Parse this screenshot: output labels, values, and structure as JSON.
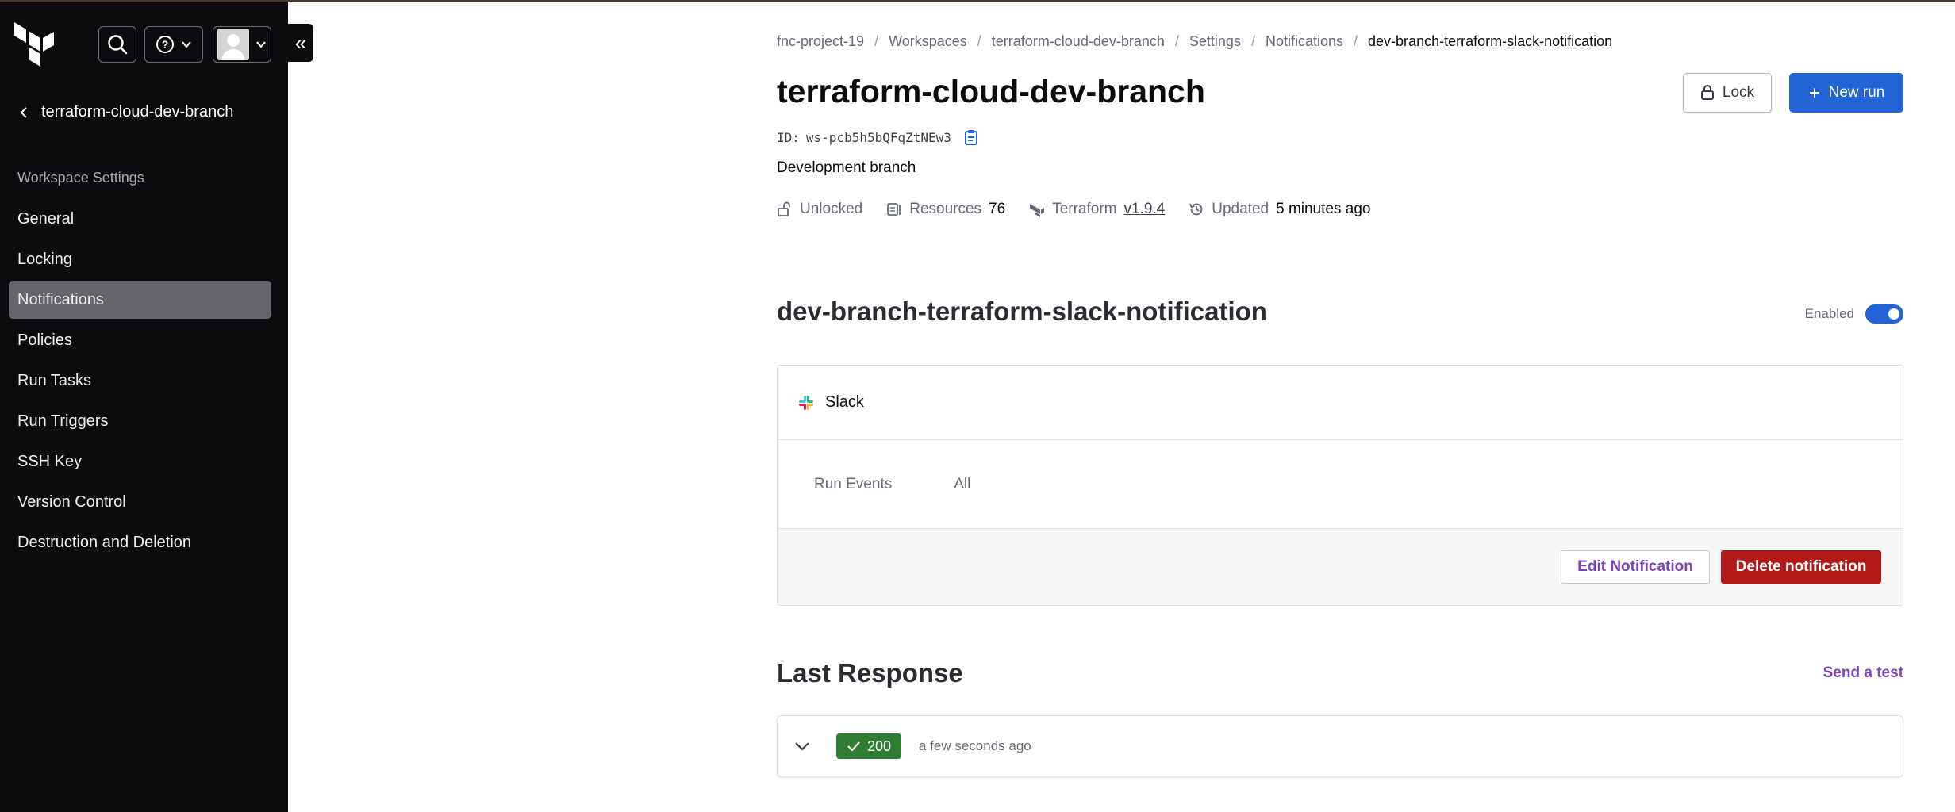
{
  "sidebar": {
    "back_label": "terraform-cloud-dev-branch",
    "section_label": "Workspace Settings",
    "items": [
      {
        "label": "General"
      },
      {
        "label": "Locking"
      },
      {
        "label": "Notifications",
        "active": true
      },
      {
        "label": "Policies"
      },
      {
        "label": "Run Tasks"
      },
      {
        "label": "Run Triggers"
      },
      {
        "label": "SSH Key"
      },
      {
        "label": "Version Control"
      },
      {
        "label": "Destruction and Deletion"
      }
    ],
    "collapse_glyph": "«"
  },
  "breadcrumb": [
    "fnc-project-19",
    "Workspaces",
    "terraform-cloud-dev-branch",
    "Settings",
    "Notifications",
    "dev-branch-terraform-slack-notification"
  ],
  "workspace": {
    "title": "terraform-cloud-dev-branch",
    "id_label": "ID:",
    "id_value": "ws-pcb5h5bQFqZtNEw3",
    "description": "Development branch",
    "lock_label": "Lock",
    "new_run_label": "New run",
    "meta": {
      "lock_status": "Unlocked",
      "resources_label": "Resources",
      "resources_count": "76",
      "terraform_label": "Terraform",
      "terraform_version": "v1.9.4",
      "updated_label": "Updated",
      "updated_value": "5 minutes ago"
    }
  },
  "notification": {
    "name": "dev-branch-terraform-slack-notification",
    "enabled_label": "Enabled",
    "enabled": true,
    "destination": "Slack",
    "events_label": "Run Events",
    "events_value": "All",
    "edit_label": "Edit Notification",
    "delete_label": "Delete notification"
  },
  "last_response": {
    "heading": "Last Response",
    "send_test_label": "Send a test",
    "status_code": "200",
    "time": "a few seconds ago"
  },
  "colors": {
    "primary": "#2264d6",
    "danger": "#b21a1a",
    "link_purple": "#7b42bc",
    "success": "#2e7d32",
    "sidebar_bg": "#0c0c0e"
  }
}
